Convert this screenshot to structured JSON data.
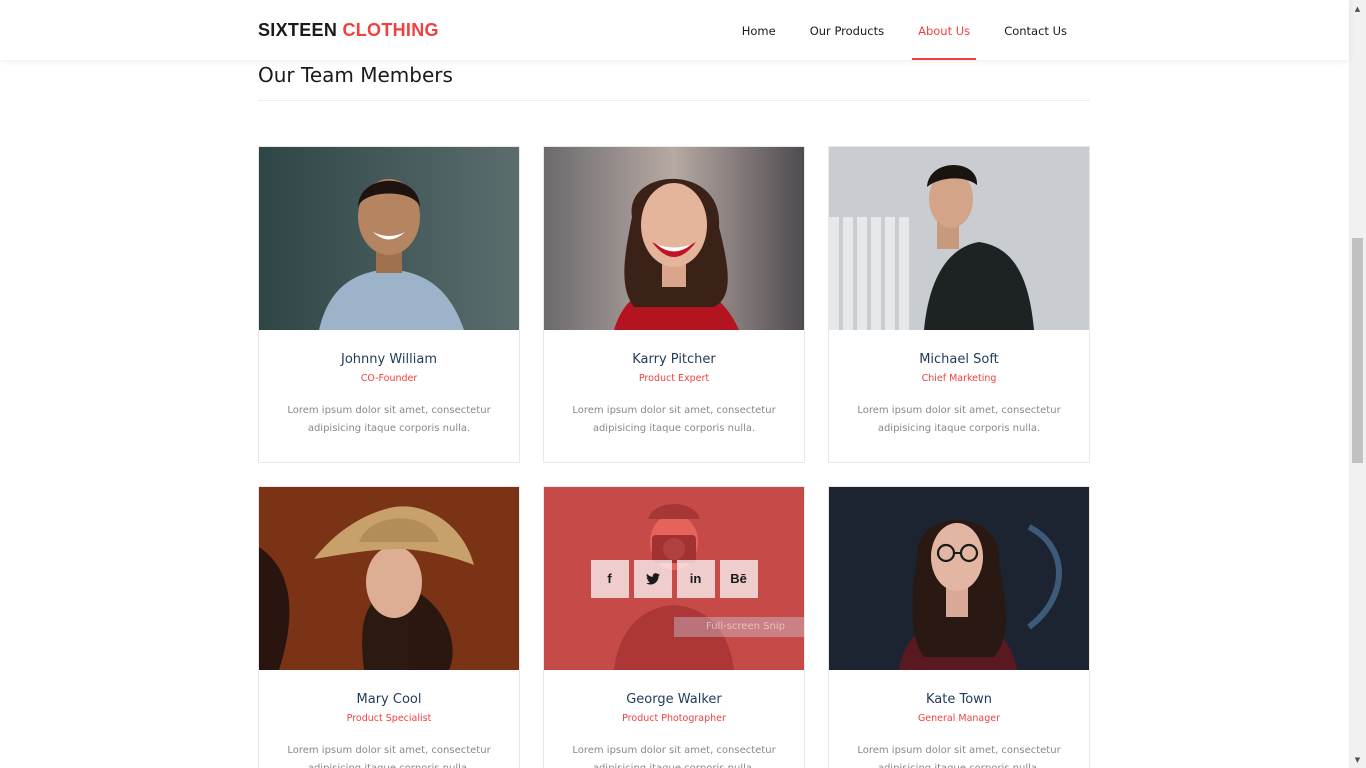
{
  "header": {
    "brand_main": "SIXTEEN",
    "brand_accent": "CLOTHING",
    "nav": [
      {
        "label": "Home",
        "active": false
      },
      {
        "label": "Our Products",
        "active": false
      },
      {
        "label": "About Us",
        "active": true
      },
      {
        "label": "Contact Us",
        "active": false
      }
    ]
  },
  "section": {
    "title": "Our Team Members"
  },
  "team": [
    {
      "name": "Johnny William",
      "role": "CO-Founder",
      "desc": "Lorem ipsum dolor sit amet, consectetur adipisicing itaque corporis nulla.",
      "photo": "man in blue shirt smiling"
    },
    {
      "name": "Karry Pitcher",
      "role": "Product Expert",
      "desc": "Lorem ipsum dolor sit amet, consectetur adipisicing itaque corporis nulla.",
      "photo": "woman laughing in red top"
    },
    {
      "name": "Michael Soft",
      "role": "Chief Marketing",
      "desc": "Lorem ipsum dolor sit amet, consectetur adipisicing itaque corporis nulla.",
      "photo": "man in dark jacket by white fence"
    },
    {
      "name": "Mary Cool",
      "role": "Product Specialist",
      "desc": "Lorem ipsum dolor sit amet, consectetur adipisicing itaque corporis nulla.",
      "photo": "woman in straw hat"
    },
    {
      "name": "George Walker",
      "role": "Product Photographer",
      "desc": "Lorem ipsum dolor sit amet, consectetur adipisicing itaque corporis nulla.",
      "photo": "man holding camera"
    },
    {
      "name": "Kate Town",
      "role": "General Manager",
      "desc": "Lorem ipsum dolor sit amet, consectetur adipisicing itaque corporis nulla.",
      "photo": "woman with glasses"
    }
  ],
  "hover_overlay": {
    "card_index": 4,
    "social": [
      {
        "icon": "facebook-icon",
        "glyph": "f"
      },
      {
        "icon": "twitter-icon",
        "glyph": "t"
      },
      {
        "icon": "linkedin-icon",
        "glyph": "in"
      },
      {
        "icon": "behance-icon",
        "glyph": "Bē"
      }
    ],
    "hint": "Full-screen Snip"
  },
  "colors": {
    "accent": "#f33f3f",
    "name": "#1f3b5a",
    "text_muted": "#888888"
  }
}
